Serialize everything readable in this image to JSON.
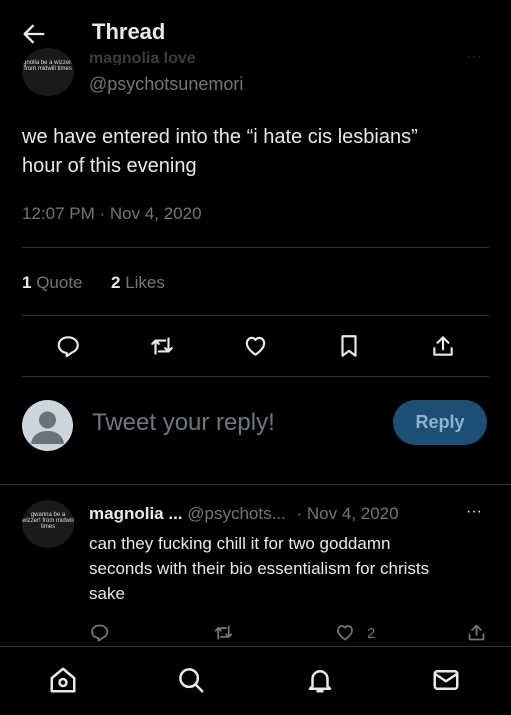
{
  "header": {
    "title": "Thread"
  },
  "tweet": {
    "display_name": "magnolia love",
    "handle": "@psychotsunemori",
    "avatar_text": "gnolia be a wizzer! from midwill times",
    "text_line1": "we have entered into the “i hate cis lesbians”",
    "text_line2": "hour of this evening",
    "timestamp": "12:07 PM · Nov 4, 2020",
    "quotes_count": "1",
    "quotes_label": "Quote",
    "likes_count": "2",
    "likes_label": "Likes",
    "more_glyph": "···"
  },
  "reply_box": {
    "placeholder": "Tweet your reply!",
    "button_label": "Reply"
  },
  "reply": {
    "display_name": "magnolia ...",
    "handle": "@psychots...",
    "date": "· Nov 4, 2020",
    "more_glyph": "···",
    "avatar_text": "gwanna be a wizzer! from midwill times",
    "line1": "can they fucking chill it for two goddamn",
    "line2": "seconds with their bio essentialism for christs",
    "line3": "sake",
    "like_count": "2"
  },
  "icons": {
    "back": "back-arrow-icon",
    "reply": "reply-icon",
    "retweet": "retweet-icon",
    "like": "heart-icon",
    "bookmark": "bookmark-icon",
    "share": "share-icon",
    "home": "home-icon",
    "search": "search-icon",
    "notifications": "bell-icon",
    "messages": "mail-icon"
  },
  "colors": {
    "background": "#000000",
    "text": "#e7e9ea",
    "muted": "#71767b",
    "divider": "#2f3336",
    "reply_button": "#1d4e74",
    "reply_button_text": "#8eb3cf"
  }
}
